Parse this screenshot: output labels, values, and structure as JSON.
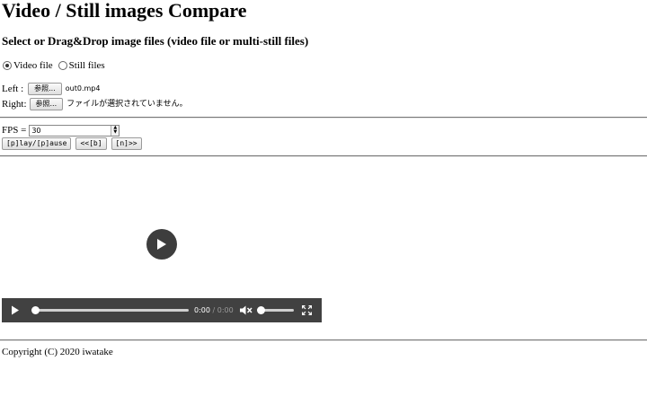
{
  "page": {
    "title": "Video / Still images Compare",
    "subtitle": "Select or Drag&Drop image files (video file or multi-still files)"
  },
  "mode": {
    "options": [
      {
        "label": "Video file",
        "checked": true
      },
      {
        "label": "Still files",
        "checked": false
      }
    ]
  },
  "files": {
    "left": {
      "label": "Left :",
      "button": "参照...",
      "filename": "out0.mp4"
    },
    "right": {
      "label": "Right:",
      "button": "参照...",
      "filename": "ファイルが選択されていません。"
    }
  },
  "fps": {
    "label": "FPS =",
    "value": "30"
  },
  "controls": {
    "play_pause": "[p]lay/[p]ause",
    "prev": "<<[b]",
    "next": "[n]>>"
  },
  "video": {
    "current_time": "0:00",
    "separator": " / ",
    "duration": "0:00",
    "progress": 0,
    "volume": 0,
    "muted": true,
    "icons": [
      "play-icon",
      "mute-icon",
      "fullscreen-icon"
    ]
  },
  "footer": {
    "copyright": "Copyright (C) 2020 iwatake"
  }
}
